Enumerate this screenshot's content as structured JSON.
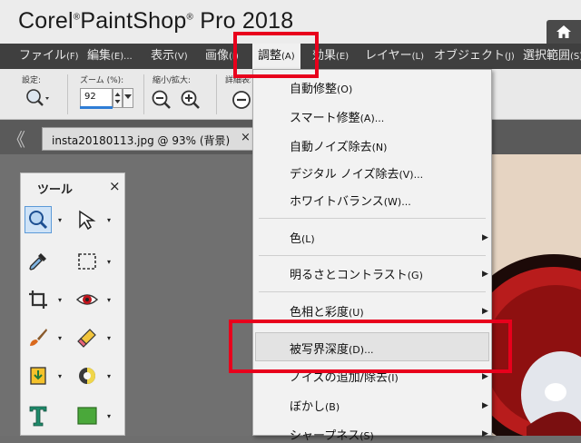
{
  "app": {
    "title_part1": "Corel",
    "reg1": "®",
    "title_part2": "PaintShop",
    "reg2": "®",
    "title_part3": "Pro 2018"
  },
  "menubar": {
    "items": [
      {
        "label": "ファイル",
        "acc": "(F)"
      },
      {
        "label": "編集",
        "acc": "(E)..."
      },
      {
        "label": "表示",
        "acc": "(V)"
      },
      {
        "label": "画像",
        "acc": "(I)"
      },
      {
        "label": "調整",
        "acc": "(A)"
      },
      {
        "label": "効果",
        "acc": "(E)"
      },
      {
        "label": "レイヤー",
        "acc": "(L)"
      },
      {
        "label": "オブジェクト",
        "acc": "(J)"
      },
      {
        "label": "選択範囲",
        "acc": "(S)"
      }
    ]
  },
  "toolbar": {
    "preset_label": "設定:",
    "zoom_label": "ズーム (%):",
    "zoom_value": "92",
    "zoomout_label": "縮小/拡大:",
    "detail_label": "詳細表示:"
  },
  "doctab": {
    "title": "insta20180113.jpg @ 93% (背景)",
    "close": "×",
    "nav": "《"
  },
  "tools": {
    "title": "ツール",
    "close": "×"
  },
  "adjust_menu": {
    "items": [
      {
        "label": "自動修整",
        "acc": "(O)",
        "submenu": false
      },
      {
        "label": "スマート修整",
        "acc": "(A)...",
        "submenu": false
      },
      {
        "label": "自動ノイズ除去",
        "acc": "(N)",
        "submenu": false
      },
      {
        "label": "デジタル ノイズ除去",
        "acc": "(V)...",
        "submenu": false
      },
      {
        "label": "ホワイトバランス",
        "acc": "(W)...",
        "submenu": false
      },
      {
        "label": "色",
        "acc": "(L)",
        "submenu": true
      },
      {
        "label": "明るさとコントラスト",
        "acc": "(G)",
        "submenu": true
      },
      {
        "label": "色相と彩度",
        "acc": "(U)",
        "submenu": true
      },
      {
        "label": "被写界深度",
        "acc": "(D)...",
        "submenu": false
      },
      {
        "label": "ノイズの追加/除去",
        "acc": "(I)",
        "submenu": true
      },
      {
        "label": "ぼかし",
        "acc": "(B)",
        "submenu": true
      },
      {
        "label": "シャープネス",
        "acc": "(S)",
        "submenu": true
      }
    ]
  },
  "colors": {
    "annotation": "#e8001c",
    "menubar_bg": "#3f3f3f",
    "selection_blue": "#2e7dd6"
  }
}
